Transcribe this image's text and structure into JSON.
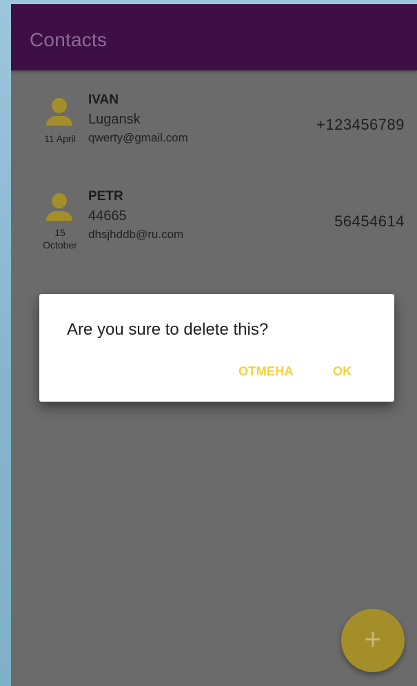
{
  "appbar": {
    "title": "Contacts"
  },
  "contacts": [
    {
      "avatar_icon": "person-icon",
      "date": "11 April",
      "name": "IVAN",
      "city": "Lugansk",
      "email": "qwerty@gmail.com",
      "phone": "+123456789"
    },
    {
      "avatar_icon": "person-icon",
      "date_line1": "15",
      "date_line2": "October",
      "name": "PETR",
      "city": "44665",
      "email": "dhsjhddb@ru.com",
      "phone": "56454614"
    }
  ],
  "dialog": {
    "message": "Are you sure to delete this?",
    "cancel_label": "ОТМЕНА",
    "ok_label": "OK"
  },
  "fab": {
    "icon": "plus-icon",
    "glyph": "+"
  },
  "colors": {
    "appbar": "#3e0f46",
    "accent": "#f3d236",
    "avatar": "#a48e2a",
    "scrim": "#6b6b6b",
    "dialog": "#ffffff"
  }
}
